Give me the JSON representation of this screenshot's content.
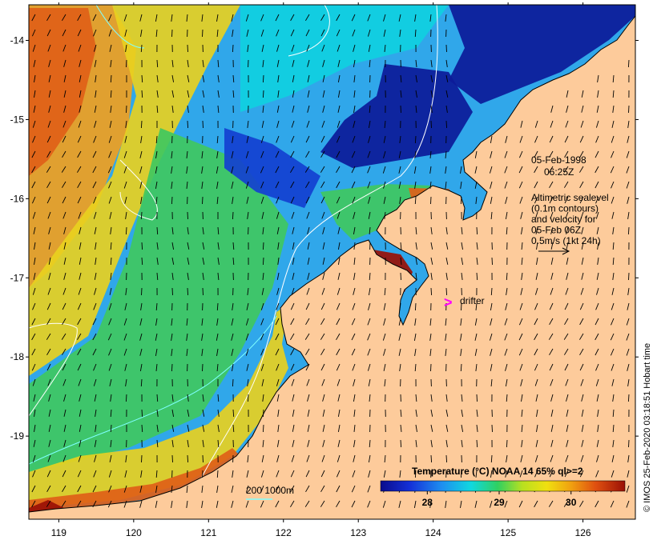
{
  "map": {
    "x_ticks": [
      "119",
      "120",
      "121",
      "122",
      "123",
      "124",
      "125",
      "126"
    ],
    "y_ticks": [
      "-14",
      "-15",
      "-16",
      "-17",
      "-18",
      "-19"
    ],
    "lon_range": [
      118.6,
      126.7
    ],
    "lat_range": [
      -13.55,
      -20.05
    ]
  },
  "annotations": {
    "date": "05-Feb-1998",
    "time": "06:25Z",
    "legend_lines": [
      "Altimetric sealevel",
      "(0.1m contours)",
      "and velocity for",
      "05-Feb 06Z",
      "0.5m/s (1kt 24h)"
    ],
    "drifter_marker": ">",
    "drifter_label": "drifter",
    "bathy_label": "200  1000m"
  },
  "colorbar": {
    "title": "Temperature (°C) NOAA 14 65% ql>=2",
    "ticks": [
      "28",
      "29",
      "30"
    ]
  },
  "credit": "© IMOS 25-Feb-2020 03:18:51 Hobart time",
  "colors": {
    "land": "#fdcb9b",
    "drifter": "#ff00ff",
    "contour_white": "#ffffff",
    "contour_cyan": "#7fffff",
    "arrow": "#000000"
  }
}
